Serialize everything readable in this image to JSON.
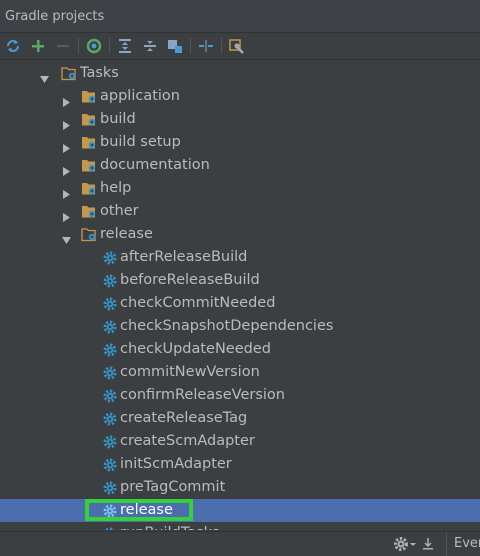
{
  "panel": {
    "title": "Gradle projects"
  },
  "toolbar": {
    "buttons": [
      {
        "name": "refresh-icon"
      },
      {
        "name": "add-icon"
      },
      {
        "name": "remove-icon"
      },
      {
        "name": "execute-task-icon"
      },
      {
        "name": "expand-all-icon"
      },
      {
        "name": "collapse-all-icon"
      },
      {
        "name": "group-tasks-icon"
      },
      {
        "name": "toggle-offline-icon"
      },
      {
        "name": "settings-wrench-icon"
      }
    ]
  },
  "tree": {
    "root": {
      "label": "Tasks",
      "expanded": true
    },
    "groups": [
      {
        "label": "application"
      },
      {
        "label": "build"
      },
      {
        "label": "build setup"
      },
      {
        "label": "documentation"
      },
      {
        "label": "help"
      },
      {
        "label": "other"
      }
    ],
    "release_group": {
      "label": "release",
      "expanded": true,
      "tasks": [
        {
          "label": "afterReleaseBuild"
        },
        {
          "label": "beforeReleaseBuild"
        },
        {
          "label": "checkCommitNeeded"
        },
        {
          "label": "checkSnapshotDependencies"
        },
        {
          "label": "checkUpdateNeeded"
        },
        {
          "label": "commitNewVersion"
        },
        {
          "label": "confirmReleaseVersion"
        },
        {
          "label": "createReleaseTag"
        },
        {
          "label": "createScmAdapter"
        },
        {
          "label": "initScmAdapter"
        },
        {
          "label": "preTagCommit"
        },
        {
          "label": "release",
          "selected": true
        },
        {
          "label": "runBuildTasks"
        }
      ]
    }
  },
  "statusbar": {
    "events_tab": "Even"
  },
  "colors": {
    "background": "#3c3f41",
    "selection": "#4b6eaf",
    "folder": "#c3974d",
    "gear": "#3592c4",
    "highlight_box": "#36d13a"
  }
}
